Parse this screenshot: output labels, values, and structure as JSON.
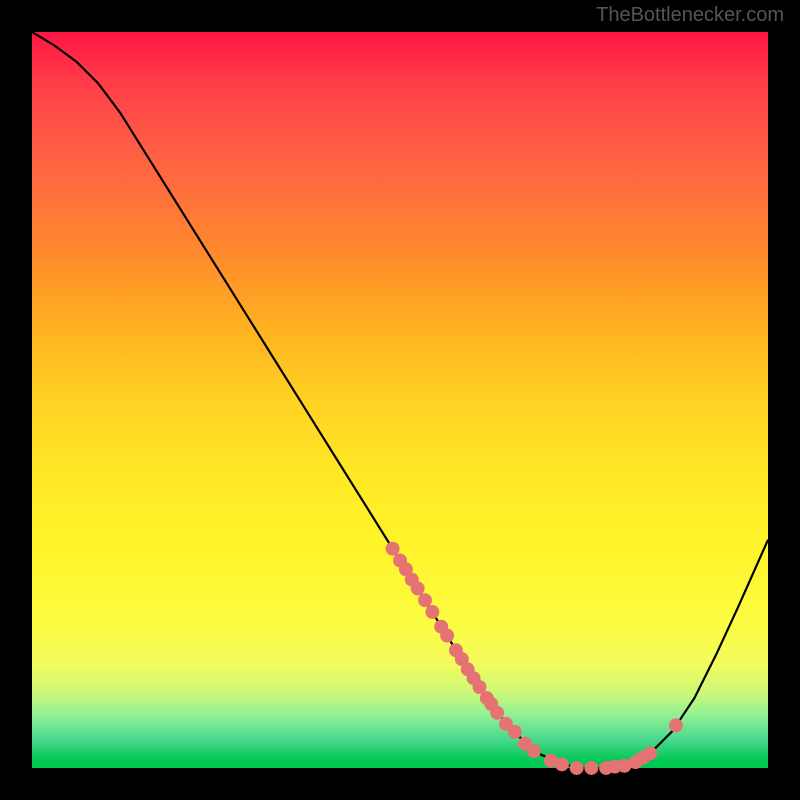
{
  "watermark": "TheBottlenecker.com",
  "chart_data": {
    "type": "line",
    "title": "",
    "xlabel": "",
    "ylabel": "",
    "xlim": [
      0,
      100
    ],
    "ylim": [
      0,
      100
    ],
    "curve": [
      {
        "x": 0.0,
        "y": 100.0
      },
      {
        "x": 3.0,
        "y": 98.2
      },
      {
        "x": 6.0,
        "y": 96.0
      },
      {
        "x": 9.0,
        "y": 93.0
      },
      {
        "x": 12.0,
        "y": 89.0
      },
      {
        "x": 15.0,
        "y": 84.2
      },
      {
        "x": 18.0,
        "y": 79.4
      },
      {
        "x": 21.0,
        "y": 74.6
      },
      {
        "x": 24.0,
        "y": 69.8
      },
      {
        "x": 27.0,
        "y": 65.0
      },
      {
        "x": 30.0,
        "y": 60.2
      },
      {
        "x": 33.0,
        "y": 55.4
      },
      {
        "x": 36.0,
        "y": 50.6
      },
      {
        "x": 39.0,
        "y": 45.8
      },
      {
        "x": 42.0,
        "y": 41.0
      },
      {
        "x": 45.0,
        "y": 36.2
      },
      {
        "x": 48.0,
        "y": 31.4
      },
      {
        "x": 51.0,
        "y": 26.6
      },
      {
        "x": 54.0,
        "y": 21.8
      },
      {
        "x": 57.0,
        "y": 17.0
      },
      {
        "x": 60.0,
        "y": 12.2
      },
      {
        "x": 63.0,
        "y": 7.8
      },
      {
        "x": 66.0,
        "y": 4.4
      },
      {
        "x": 69.0,
        "y": 1.9
      },
      {
        "x": 72.0,
        "y": 0.5
      },
      {
        "x": 75.0,
        "y": 0.0
      },
      {
        "x": 78.0,
        "y": 0.0
      },
      {
        "x": 81.0,
        "y": 0.5
      },
      {
        "x": 84.0,
        "y": 2.0
      },
      {
        "x": 87.0,
        "y": 5.0
      },
      {
        "x": 90.0,
        "y": 9.5
      },
      {
        "x": 93.0,
        "y": 15.5
      },
      {
        "x": 96.0,
        "y": 22.0
      },
      {
        "x": 100.0,
        "y": 31.0
      }
    ],
    "markers": [
      {
        "x": 49.0,
        "y": 29.8
      },
      {
        "x": 50.0,
        "y": 28.2
      },
      {
        "x": 50.8,
        "y": 27.0
      },
      {
        "x": 51.6,
        "y": 25.6
      },
      {
        "x": 52.4,
        "y": 24.4
      },
      {
        "x": 53.4,
        "y": 22.8
      },
      {
        "x": 54.4,
        "y": 21.2
      },
      {
        "x": 55.6,
        "y": 19.2
      },
      {
        "x": 56.4,
        "y": 18.0
      },
      {
        "x": 57.6,
        "y": 16.0
      },
      {
        "x": 58.4,
        "y": 14.8
      },
      {
        "x": 59.2,
        "y": 13.4
      },
      {
        "x": 60.0,
        "y": 12.2
      },
      {
        "x": 60.8,
        "y": 11.0
      },
      {
        "x": 61.8,
        "y": 9.5
      },
      {
        "x": 62.4,
        "y": 8.7
      },
      {
        "x": 63.2,
        "y": 7.5
      },
      {
        "x": 64.4,
        "y": 6.0
      },
      {
        "x": 65.6,
        "y": 4.9
      },
      {
        "x": 67.0,
        "y": 3.3
      },
      {
        "x": 68.2,
        "y": 2.3
      },
      {
        "x": 70.5,
        "y": 1.0
      },
      {
        "x": 72.0,
        "y": 0.5
      },
      {
        "x": 74.0,
        "y": 0.0
      },
      {
        "x": 76.0,
        "y": 0.0
      },
      {
        "x": 78.0,
        "y": 0.0
      },
      {
        "x": 79.2,
        "y": 0.2
      },
      {
        "x": 80.5,
        "y": 0.3
      },
      {
        "x": 82.0,
        "y": 0.8
      },
      {
        "x": 83.0,
        "y": 1.4
      },
      {
        "x": 84.0,
        "y": 2.0
      },
      {
        "x": 87.5,
        "y": 5.8
      }
    ],
    "marker_color": "#e57373",
    "line_color": "#000000"
  }
}
